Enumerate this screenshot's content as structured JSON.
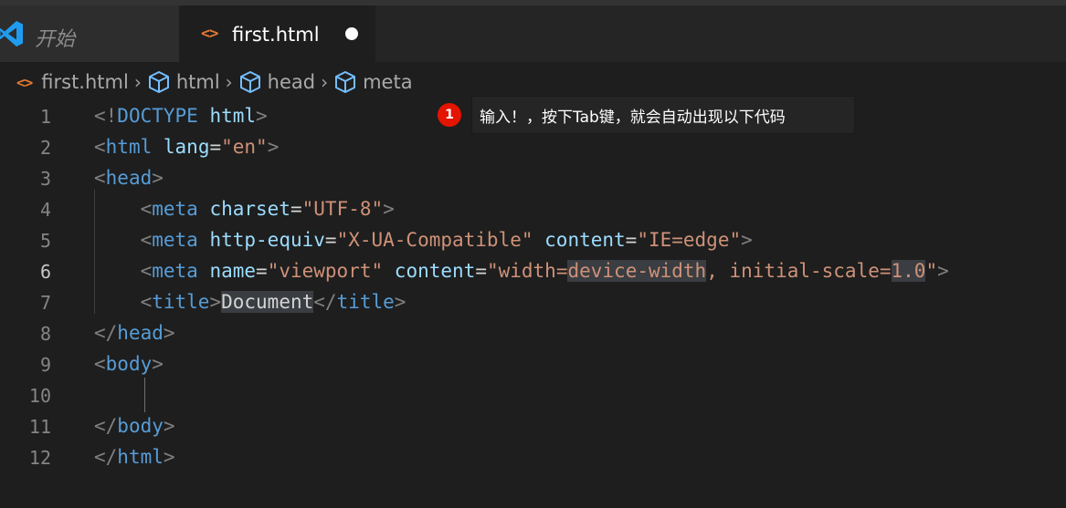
{
  "tabs": {
    "start_label": "开始",
    "active_label": "first.html",
    "active_icon": "code-brackets-icon",
    "dirty": true
  },
  "breadcrumb": {
    "file": "first.html",
    "items": [
      "html",
      "head",
      "meta"
    ]
  },
  "tooltip": {
    "badge": "1",
    "text": "输入！，按下Tab键，就会自动出现以下代码"
  },
  "editor": {
    "active_line": 6,
    "line_numbers": [
      "1",
      "2",
      "3",
      "4",
      "5",
      "6",
      "7",
      "8",
      "9",
      "10",
      "11",
      "12"
    ]
  },
  "colors": {
    "tag": "#569cd6",
    "attribute": "#9cdcfe",
    "string": "#ce9178",
    "punctuation": "#808080",
    "background": "#1e1e1e",
    "badge": "#e51400",
    "file_icon": "#e37933"
  }
}
